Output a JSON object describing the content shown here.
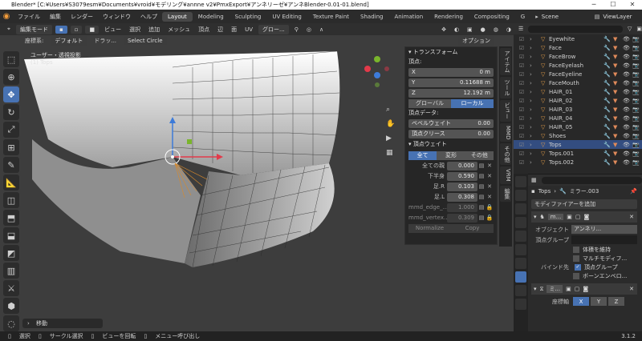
{
  "titlebar": {
    "text": "Blender* [C:¥Users¥S3079esm¥Documents¥vroid¥モデリング¥annne v2¥PmxExport¥アンネリーゼ¥アンネBlender-0.01-01.blend]"
  },
  "menu": {
    "items": [
      "ファイル",
      "編集",
      "レンダー",
      "ウィンドウ",
      "ヘルプ"
    ],
    "workspaces": [
      "Layout",
      "Modeling",
      "Sculpting",
      "UV Editing",
      "Texture Paint",
      "Shading",
      "Animation",
      "Rendering",
      "Compositing",
      "G"
    ],
    "scene": "Scene",
    "viewlayer": "ViewLayer"
  },
  "viewport_header": {
    "mode": "編集モード",
    "items": [
      "ビュー",
      "選択",
      "追加",
      "メッシュ",
      "頂点",
      "辺",
      "面",
      "UV"
    ],
    "orientation": "グロー...",
    "options": "オプション"
  },
  "tool_settings": {
    "coord_label": "座標系:",
    "coord_value": "デフォルト",
    "drag_label": "ドラッ...",
    "select_mode": "Select Circle"
  },
  "viewport": {
    "view_name": "ユーザー・透視投影",
    "object_name": "(1) Tops"
  },
  "npanel": {
    "transform_header": "トランスフォーム",
    "vertex_label": "頂点:",
    "x_label": "X",
    "x_value": "0 m",
    "y_label": "Y",
    "y_value": "0.11688 m",
    "z_label": "Z",
    "z_value": "12.192 m",
    "global_btn": "グローバル",
    "local_btn": "ローカル",
    "vertex_data": "頂点データ:",
    "bevel_label": "ベベルウェイト",
    "bevel_value": "0.00",
    "crease_label": "頂点クリース",
    "crease_value": "0.00",
    "vw_header": "頂点ウェイト",
    "tab_all": "全て",
    "tab_deform": "変形",
    "tab_other": "その他",
    "weights": [
      {
        "name": "全ての親",
        "value": "0.000"
      },
      {
        "name": "下半身",
        "value": "0.590"
      },
      {
        "name": "足.R",
        "value": "0.103"
      },
      {
        "name": "足.L",
        "value": "0.308"
      },
      {
        "name": "mmd_edge_...",
        "value": "1.000"
      },
      {
        "name": "mmd_vertex...",
        "value": "0.309"
      }
    ],
    "normalize_btn": "Normalize",
    "copy_btn": "Copy"
  },
  "sidetabs": [
    "アイテム",
    "ツール",
    "ビュー",
    "MMD",
    "その他",
    "VRM",
    "編集"
  ],
  "outliner": {
    "items": [
      "Eyewhite",
      "Face",
      "FaceBrow",
      "FaceEyelash",
      "FaceEyeline",
      "FaceMouth",
      "HAIR_01",
      "HAIR_02",
      "HAIR_03",
      "HAIR_04",
      "HAIR_05",
      "Shoes",
      "Tops",
      "Tops.001",
      "Tops.002"
    ],
    "selected_index": 12
  },
  "properties": {
    "object_name": "Tops",
    "mesh_name": "ミラー.003",
    "add_modifier": "モディファイアーを追加",
    "modifier1_name": "m...",
    "object_label": "オブジェクト",
    "object_value": "アンネリ...",
    "vgroup_label": "頂点グループ",
    "keep_volume": "体積を維持",
    "multi_modifier": "マルチモディフ...",
    "bind_label": "バインド先",
    "bind_vgroups": "頂点グループ",
    "bind_envelope": "ボーンエンベロ...",
    "modifier2_name": "ミ...",
    "axis_label": "座標軸",
    "axes": [
      "X",
      "Y",
      "Z"
    ]
  },
  "status": {
    "items": [
      "選択",
      "サークル選択",
      "ビューを回転",
      "メニュー呼び出し"
    ],
    "version": "3.1.2"
  },
  "operator_panel": "移動",
  "colors": {
    "accent": "#4772b3",
    "x_axis": "#e23a4a",
    "y_axis": "#7ab52c",
    "z_axis": "#3d7bd9"
  }
}
